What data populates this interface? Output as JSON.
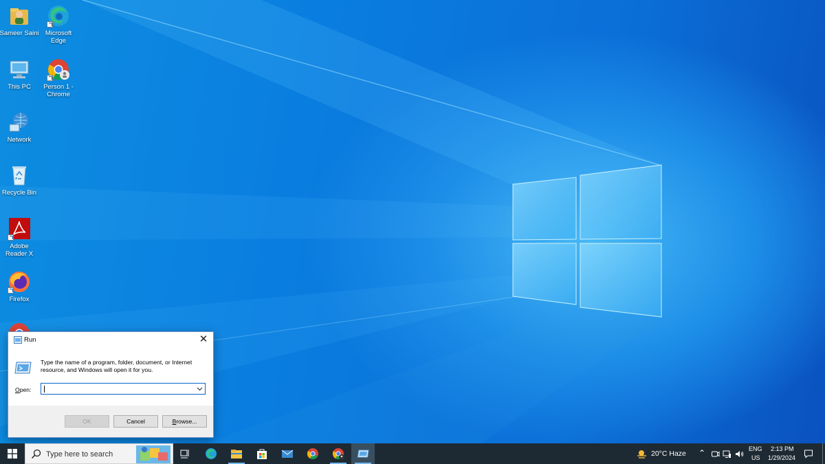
{
  "desktop": {
    "icons": [
      {
        "label": "Sameer Saini",
        "icon": "user-folder-icon"
      },
      {
        "label": "Microsoft Edge",
        "icon": "edge-icon"
      },
      {
        "label": "This PC",
        "icon": "this-pc-icon"
      },
      {
        "label": "Person 1 - Chrome",
        "icon": "chrome-profile-icon"
      },
      {
        "label": "Network",
        "icon": "network-icon"
      },
      {
        "label": "Recycle Bin",
        "icon": "recycle-bin-icon"
      },
      {
        "label": "Adobe Reader X",
        "icon": "adobe-reader-icon"
      },
      {
        "label": "Firefox",
        "icon": "firefox-icon"
      },
      {
        "label": "",
        "icon": "chrome-icon"
      }
    ]
  },
  "run_dialog": {
    "title": "Run",
    "description": "Type the name of a program, folder, document, or Internet resource, and Windows will open it for you.",
    "open_label_prefix": "",
    "open_label_underlined": "O",
    "open_label_rest": "pen:",
    "input_value": "",
    "ok_label": "OK",
    "cancel_label": "Cancel",
    "browse_label_underlined": "B",
    "browse_label_rest": "rowse..."
  },
  "taskbar": {
    "search_placeholder": "Type here to search",
    "apps": [
      "task-view-icon",
      "edge-icon",
      "file-explorer-icon",
      "microsoft-store-icon",
      "mail-icon",
      "chrome-icon",
      "chrome-profile-icon",
      "run-icon"
    ],
    "weather": "20°C  Haze",
    "language_top": "ENG",
    "language_bottom": "US",
    "time": "2:13 PM",
    "date": "1/29/2024"
  },
  "colors": {
    "taskbar": "#1e2a33",
    "accent": "#0a64c8",
    "desktop": "#0b78de"
  }
}
